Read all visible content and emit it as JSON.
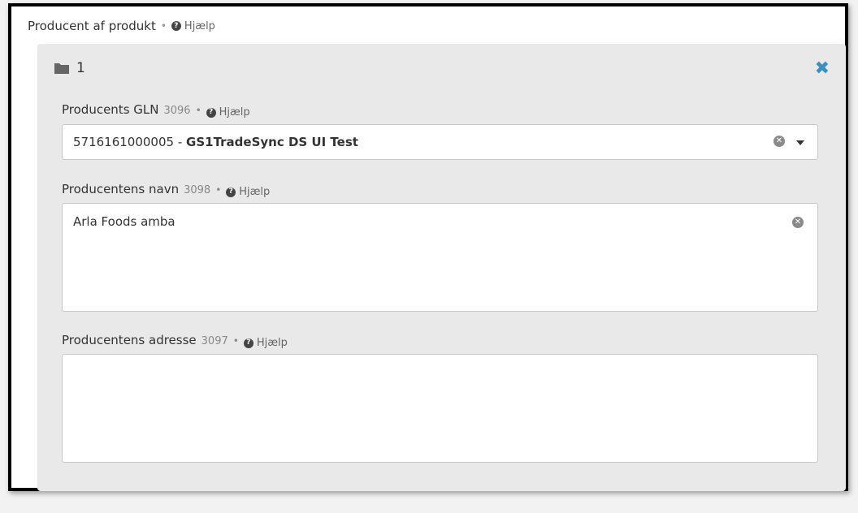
{
  "section": {
    "title": "Producent af produkt",
    "separator": "•",
    "help_label": "Hjælp"
  },
  "panel": {
    "index": "1",
    "close_symbol": "✖"
  },
  "fields": [
    {
      "label": "Producents GLN",
      "code": "3096",
      "separator": "•",
      "help_label": "Hjælp",
      "value_prefix": "5716161000005 - ",
      "value_bold": "GS1TradeSync DS UI Test",
      "clear_symbol": "✕"
    },
    {
      "label": "Producentens navn",
      "code": "3098",
      "separator": "•",
      "help_label": "Hjælp",
      "value": "Arla Foods amba",
      "clear_symbol": "✕"
    },
    {
      "label": "Producentens adresse",
      "code": "3097",
      "separator": "•",
      "help_label": "Hjælp",
      "value": ""
    }
  ],
  "icons": {
    "help": "?",
    "folder": "folder-icon",
    "close": "close-icon",
    "clear": "clear-icon",
    "dropdown": "chevron-down-icon"
  },
  "colors": {
    "accent": "#3a8fc3",
    "panel_bg": "#e9e9e9",
    "field_border": "#c8c8c8"
  }
}
